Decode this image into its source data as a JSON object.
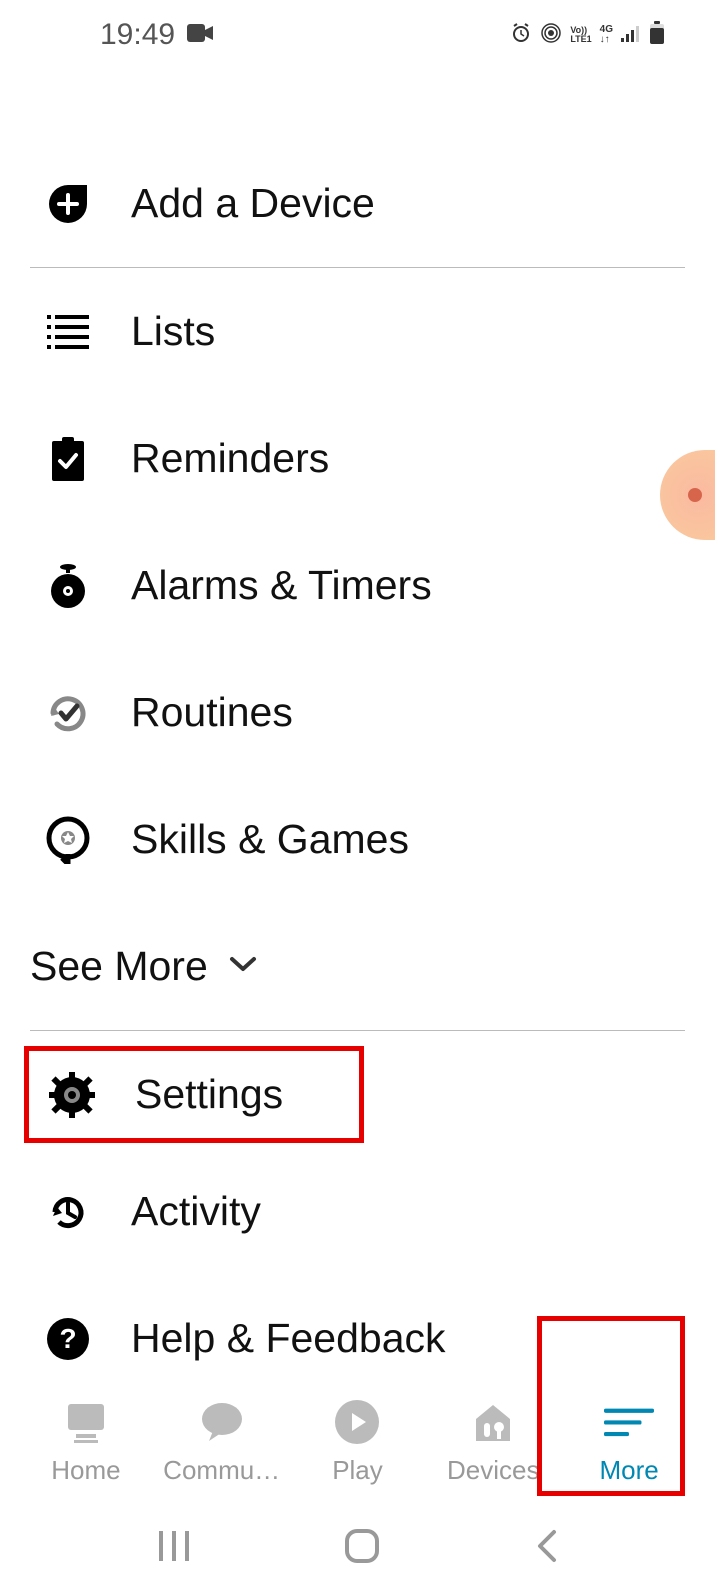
{
  "status": {
    "time": "19:49"
  },
  "menu": {
    "add_device": "Add a Device",
    "lists": "Lists",
    "reminders": "Reminders",
    "alarms": "Alarms & Timers",
    "routines": "Routines",
    "skills": "Skills & Games",
    "see_more": "See More",
    "settings": "Settings",
    "activity": "Activity",
    "help": "Help & Feedback"
  },
  "nav": {
    "home": "Home",
    "communicate": "Commu…",
    "play": "Play",
    "devices": "Devices",
    "more": "More"
  }
}
